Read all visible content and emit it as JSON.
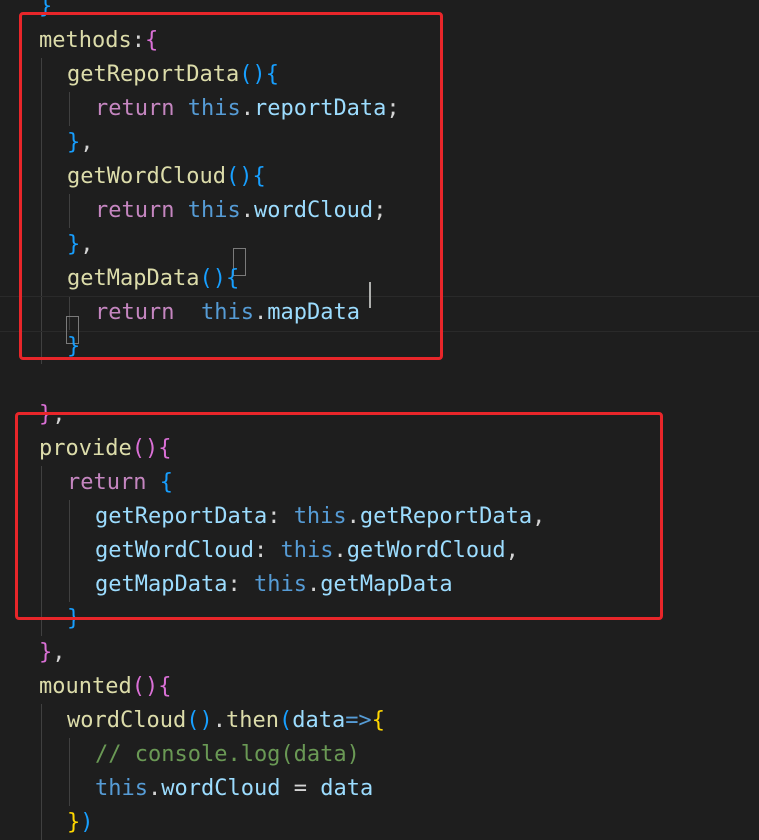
{
  "colors": {
    "background": "#1e1e1e",
    "function": "#dcdcaa",
    "keyword": "#c586c0",
    "this_keyword": "#569cd6",
    "property": "#9cdcfe",
    "plain": "#d4d4d4",
    "comment": "#6a9955",
    "bracket_gold": "#ffd700",
    "bracket_magenta": "#da70d6",
    "bracket_blue": "#179fff",
    "annotation_box": "#e8262a"
  },
  "code_lines": [
    {
      "indent": 0,
      "tokens": [
        {
          "t": "}",
          "c": "#179fff"
        }
      ]
    },
    {
      "indent": 0,
      "tokens": [
        {
          "t": "methods",
          "c": "#dcdcaa"
        },
        {
          "t": ":",
          "c": "#d4d4d4"
        },
        {
          "t": "{",
          "c": "#da70d6"
        }
      ]
    },
    {
      "indent": 1,
      "tokens": [
        {
          "t": "getReportData",
          "c": "#dcdcaa"
        },
        {
          "t": "()",
          "c": "#179fff"
        },
        {
          "t": "{",
          "c": "#179fff"
        }
      ]
    },
    {
      "indent": 2,
      "tokens": [
        {
          "t": "return",
          "c": "#c586c0"
        },
        {
          "t": " ",
          "c": "#d4d4d4"
        },
        {
          "t": "this",
          "c": "#569cd6"
        },
        {
          "t": ".",
          "c": "#d4d4d4"
        },
        {
          "t": "reportData",
          "c": "#9cdcfe"
        },
        {
          "t": ";",
          "c": "#d4d4d4"
        }
      ]
    },
    {
      "indent": 1,
      "tokens": [
        {
          "t": "}",
          "c": "#179fff"
        },
        {
          "t": ",",
          "c": "#d4d4d4"
        }
      ]
    },
    {
      "indent": 1,
      "tokens": [
        {
          "t": "getWordCloud",
          "c": "#dcdcaa"
        },
        {
          "t": "()",
          "c": "#179fff"
        },
        {
          "t": "{",
          "c": "#179fff"
        }
      ]
    },
    {
      "indent": 2,
      "tokens": [
        {
          "t": "return",
          "c": "#c586c0"
        },
        {
          "t": " ",
          "c": "#d4d4d4"
        },
        {
          "t": "this",
          "c": "#569cd6"
        },
        {
          "t": ".",
          "c": "#d4d4d4"
        },
        {
          "t": "wordCloud",
          "c": "#9cdcfe"
        },
        {
          "t": ";",
          "c": "#d4d4d4"
        }
      ]
    },
    {
      "indent": 1,
      "tokens": [
        {
          "t": "}",
          "c": "#179fff"
        },
        {
          "t": ",",
          "c": "#d4d4d4"
        }
      ]
    },
    {
      "indent": 1,
      "tokens": [
        {
          "t": "getMapData",
          "c": "#dcdcaa"
        },
        {
          "t": "()",
          "c": "#179fff"
        },
        {
          "t": "{",
          "c": "#179fff"
        }
      ]
    },
    {
      "indent": 2,
      "tokens": [
        {
          "t": "return",
          "c": "#c586c0"
        },
        {
          "t": "  ",
          "c": "#d4d4d4"
        },
        {
          "t": "this",
          "c": "#569cd6"
        },
        {
          "t": ".",
          "c": "#d4d4d4"
        },
        {
          "t": "mapData",
          "c": "#9cdcfe"
        }
      ]
    },
    {
      "indent": 1,
      "tokens": [
        {
          "t": "}",
          "c": "#179fff"
        }
      ]
    },
    {
      "indent": 0,
      "tokens": []
    },
    {
      "indent": 0,
      "tokens": [
        {
          "t": "}",
          "c": "#da70d6"
        },
        {
          "t": ",",
          "c": "#d4d4d4"
        }
      ]
    },
    {
      "indent": 0,
      "tokens": [
        {
          "t": "provide",
          "c": "#dcdcaa"
        },
        {
          "t": "()",
          "c": "#da70d6"
        },
        {
          "t": "{",
          "c": "#da70d6"
        }
      ]
    },
    {
      "indent": 1,
      "tokens": [
        {
          "t": "return",
          "c": "#c586c0"
        },
        {
          "t": " ",
          "c": "#d4d4d4"
        },
        {
          "t": "{",
          "c": "#179fff"
        }
      ]
    },
    {
      "indent": 2,
      "tokens": [
        {
          "t": "getReportData",
          "c": "#9cdcfe"
        },
        {
          "t": ": ",
          "c": "#d4d4d4"
        },
        {
          "t": "this",
          "c": "#569cd6"
        },
        {
          "t": ".",
          "c": "#d4d4d4"
        },
        {
          "t": "getReportData",
          "c": "#9cdcfe"
        },
        {
          "t": ",",
          "c": "#d4d4d4"
        }
      ]
    },
    {
      "indent": 2,
      "tokens": [
        {
          "t": "getWordCloud",
          "c": "#9cdcfe"
        },
        {
          "t": ": ",
          "c": "#d4d4d4"
        },
        {
          "t": "this",
          "c": "#569cd6"
        },
        {
          "t": ".",
          "c": "#d4d4d4"
        },
        {
          "t": "getWordCloud",
          "c": "#9cdcfe"
        },
        {
          "t": ",",
          "c": "#d4d4d4"
        }
      ]
    },
    {
      "indent": 2,
      "tokens": [
        {
          "t": "getMapData",
          "c": "#9cdcfe"
        },
        {
          "t": ": ",
          "c": "#d4d4d4"
        },
        {
          "t": "this",
          "c": "#569cd6"
        },
        {
          "t": ".",
          "c": "#d4d4d4"
        },
        {
          "t": "getMapData",
          "c": "#9cdcfe"
        }
      ]
    },
    {
      "indent": 1,
      "tokens": [
        {
          "t": "}",
          "c": "#179fff"
        }
      ]
    },
    {
      "indent": 0,
      "tokens": [
        {
          "t": "}",
          "c": "#da70d6"
        },
        {
          "t": ",",
          "c": "#d4d4d4"
        }
      ]
    },
    {
      "indent": 0,
      "tokens": [
        {
          "t": "mounted",
          "c": "#dcdcaa"
        },
        {
          "t": "()",
          "c": "#da70d6"
        },
        {
          "t": "{",
          "c": "#da70d6"
        }
      ]
    },
    {
      "indent": 1,
      "tokens": [
        {
          "t": "wordCloud",
          "c": "#dcdcaa"
        },
        {
          "t": "()",
          "c": "#179fff"
        },
        {
          "t": ".",
          "c": "#d4d4d4"
        },
        {
          "t": "then",
          "c": "#dcdcaa"
        },
        {
          "t": "(",
          "c": "#179fff"
        },
        {
          "t": "data",
          "c": "#9cdcfe"
        },
        {
          "t": "=>",
          "c": "#569cd6"
        },
        {
          "t": "{",
          "c": "#ffd700"
        }
      ]
    },
    {
      "indent": 2,
      "tokens": [
        {
          "t": "// console.log(data)",
          "c": "#6a9955"
        }
      ]
    },
    {
      "indent": 2,
      "tokens": [
        {
          "t": "this",
          "c": "#569cd6"
        },
        {
          "t": ".",
          "c": "#d4d4d4"
        },
        {
          "t": "wordCloud",
          "c": "#9cdcfe"
        },
        {
          "t": " = ",
          "c": "#d4d4d4"
        },
        {
          "t": "data",
          "c": "#9cdcfe"
        }
      ]
    },
    {
      "indent": 1,
      "tokens": [
        {
          "t": "}",
          "c": "#ffd700"
        },
        {
          "t": ")",
          "c": "#179fff"
        }
      ]
    }
  ]
}
